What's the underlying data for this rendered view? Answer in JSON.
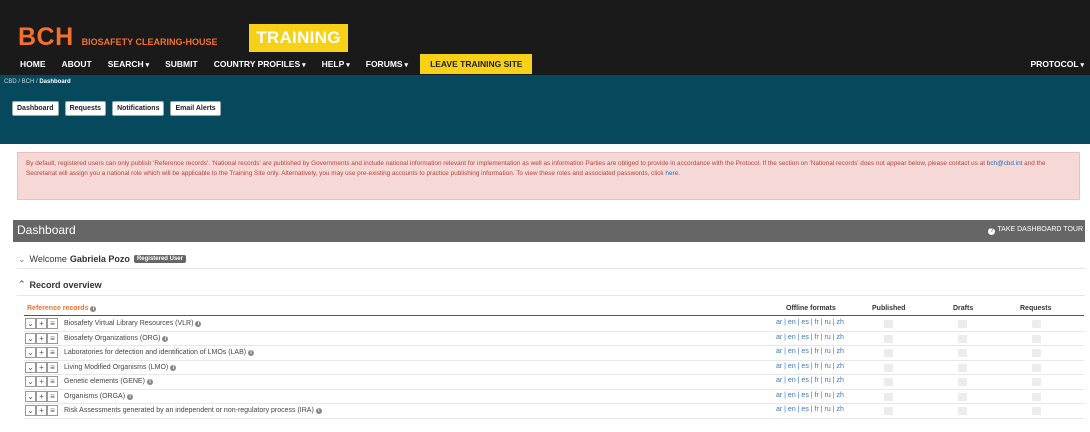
{
  "header": {
    "logo": "BCH",
    "subtitle": "BIOSAFETY CLEARING-HOUSE",
    "training_badge": "TRAINING",
    "nav": [
      {
        "label": "HOME",
        "dropdown": false
      },
      {
        "label": "ABOUT",
        "dropdown": false
      },
      {
        "label": "SEARCH",
        "dropdown": true
      },
      {
        "label": "SUBMIT",
        "dropdown": false
      },
      {
        "label": "COUNTRY PROFILES",
        "dropdown": true
      },
      {
        "label": "HELP",
        "dropdown": true
      },
      {
        "label": "FORUMS",
        "dropdown": true
      }
    ],
    "leave_training": "LEAVE TRAINING SITE",
    "protocol": "PROTOCOL"
  },
  "breadcrumb": {
    "prefix": "CBD / BCH / ",
    "current": "Dashboard"
  },
  "tabs": [
    "Dashboard",
    "Requests",
    "Notifications",
    "Email Alerts"
  ],
  "alert": {
    "text_before": "By default, registered users can only publish 'Reference records'. 'National records' are published by Governments and include national information relevant for implementation as well as information Parties are obliged to provide in accordance with the Protocol. If the section on 'National records' does not appear below, please contact us at ",
    "email": "bch@cbd.int",
    "text_middle": " and the Secretariat will assign you a national role which will be applicable to the Training Site only. Alternatively, you may use pre-existing accounts to practice publishing information. To view these roles and associated passwords, click ",
    "link": "here",
    "text_after": "."
  },
  "dashboard": {
    "title": "Dashboard",
    "tour": "TAKE DASHBOARD TOUR",
    "welcome_prefix": "Welcome",
    "user_name": "Gabriela Pozo",
    "user_badge": "Registered User",
    "record_overview": "Record overview"
  },
  "table": {
    "section_label": "Reference records",
    "headers": {
      "offline": "Offline formats",
      "published": "Published",
      "drafts": "Drafts",
      "requests": "Requests"
    },
    "languages": "ar | en | es | fr | ru | zh",
    "rows": [
      {
        "title": "Biosafety Virtual Library Resources (VLR)"
      },
      {
        "title": "Biosafety Organizations (ORG)"
      },
      {
        "title": "Laboratories for detection and identification of LMOs (LAB)"
      },
      {
        "title": "Living Modified Organisms (LMO)"
      },
      {
        "title": "Genetic elements (GENE)"
      },
      {
        "title": "Organisms (ORGA)"
      },
      {
        "title": "Risk Assessments generated by an independent or non-regulatory process (IRA)"
      }
    ]
  },
  "colors": {
    "brand_orange": "#f4702c",
    "training_yellow": "#f7d117",
    "band_blue": "#06495c",
    "header_black": "#1a1a1a"
  }
}
